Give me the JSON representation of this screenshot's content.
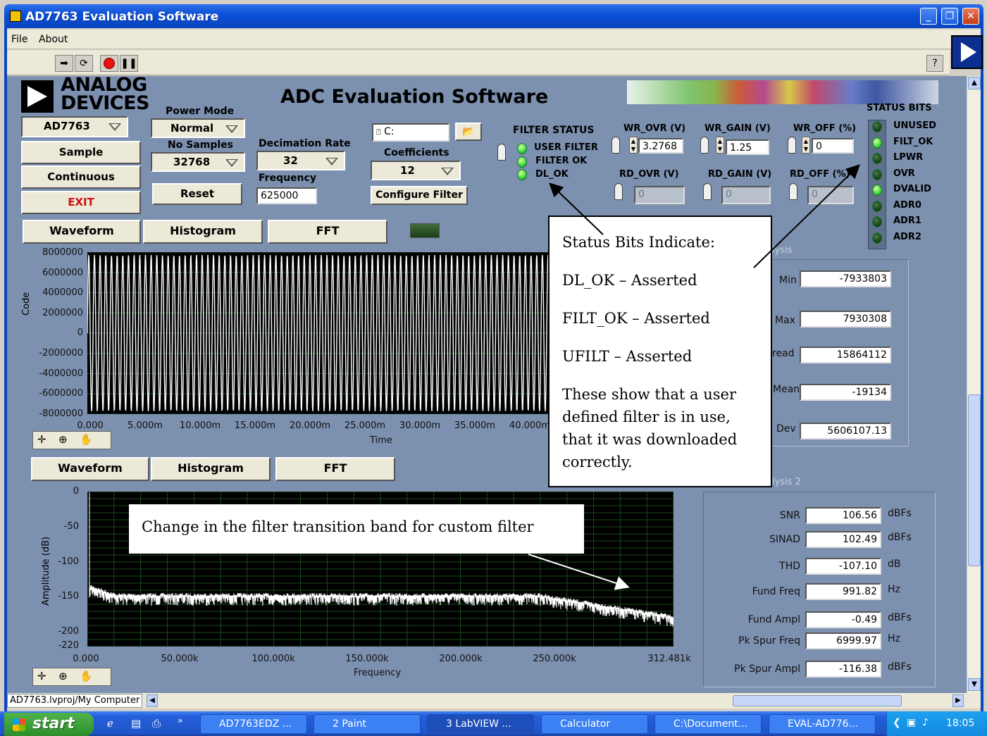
{
  "window": {
    "title": "AD7763 Evaluation Software",
    "minimize": "_",
    "maximize": "❐",
    "close": "✕"
  },
  "menu": {
    "file": "File",
    "about": "About"
  },
  "toolbar": {
    "help": "?"
  },
  "header": {
    "logo_line1": "ANALOG",
    "logo_line2": "DEVICES",
    "title": "ADC Evaluation Software"
  },
  "controls": {
    "device": "AD7763",
    "sample": "Sample",
    "continuous": "Continuous",
    "exit": "EXIT",
    "power_mode_label": "Power Mode",
    "power_mode": "Normal",
    "no_samples_label": "No Samples",
    "no_samples": "32768",
    "reset": "Reset",
    "decimation_label": "Decimation Rate",
    "decimation": "32",
    "frequency_label": "Frequency",
    "frequency": "625000",
    "path": "C:",
    "coefficients_label": "Coefficients",
    "coefficients": "12",
    "configure_filter": "Configure Filter"
  },
  "filter_status": {
    "label": "FILTER STATUS",
    "user_filter": "USER FILTER",
    "filter_ok": "FILTER OK",
    "dl_ok": "DL_OK"
  },
  "registers": {
    "wr_ovr_label": "WR_OVR (V)",
    "wr_ovr": "3.2768",
    "wr_gain_label": "WR_GAIN (V)",
    "wr_gain": "1.25",
    "wr_off_label": "WR_OFF (%)",
    "wr_off": "0",
    "rd_ovr_label": "RD_OVR (V)",
    "rd_ovr": "0",
    "rd_gain_label": "RD_GAIN (V)",
    "rd_gain": "0",
    "rd_off_label": "RD_OFF (%)",
    "rd_off": "0"
  },
  "status_bits": {
    "label": "STATUS BITS",
    "bits": [
      {
        "name": "UNUSED",
        "on": false
      },
      {
        "name": "FILT_OK",
        "on": true
      },
      {
        "name": "LPWR",
        "on": false
      },
      {
        "name": "OVR",
        "on": false
      },
      {
        "name": "DVALID",
        "on": true
      },
      {
        "name": "ADR0",
        "on": false
      },
      {
        "name": "ADR1",
        "on": false
      },
      {
        "name": "ADR2",
        "on": false
      }
    ]
  },
  "top_tabs": [
    "Waveform",
    "Histogram",
    "FFT"
  ],
  "bottom_tabs": [
    "Waveform",
    "Histogram",
    "FFT"
  ],
  "waveform": {
    "ylabel": "Code",
    "xlabel": "Time",
    "yticks": [
      "8000000",
      "6000000",
      "4000000",
      "2000000",
      "0",
      "-2000000",
      "-4000000",
      "-6000000",
      "-8000000"
    ],
    "xticks": [
      "0.000",
      "5.000m",
      "10.000m",
      "15.000m",
      "20.000m",
      "25.000m",
      "30.000m",
      "35.000m",
      "40.000m"
    ]
  },
  "fft": {
    "ylabel": "Amplitude (dB)",
    "xlabel": "Frequency",
    "yticks": [
      "0",
      "-50",
      "-100",
      "-150",
      "-200",
      "-220"
    ],
    "xticks": [
      "0.000",
      "50.000k",
      "100.000k",
      "150.000k",
      "200.000k",
      "250.000k",
      "312.481k"
    ]
  },
  "analysis": {
    "tab_fragment": "lysis",
    "min_label": "Min",
    "min": "-7933803",
    "max_label": "Max",
    "max": "7930308",
    "spread_label": "read",
    "spread": "15864112",
    "mean_label": "Mean",
    "mean": "-19134",
    "dev_label": "Dev",
    "dev": "5606107.13"
  },
  "analysis2": {
    "tab_fragment": "lysis 2",
    "rows": [
      {
        "label": "SNR",
        "value": "106.56",
        "unit": "dBFs"
      },
      {
        "label": "SINAD",
        "value": "102.49",
        "unit": "dBFs"
      },
      {
        "label": "THD",
        "value": "-107.10",
        "unit": "dB"
      },
      {
        "label": "Fund Freq",
        "value": "991.82",
        "unit": "Hz"
      },
      {
        "label": "Fund Ampl",
        "value": "-0.49",
        "unit": "dBFs"
      },
      {
        "label": "Pk Spur Freq",
        "value": "6999.97",
        "unit": "Hz"
      },
      {
        "label": "Pk Spur Ampl",
        "value": "-116.38",
        "unit": "dBFs"
      }
    ]
  },
  "callout_status": {
    "line1": "Status Bits Indicate:",
    "line2": "DL_OK – Asserted",
    "line3": "FILT_OK – Asserted",
    "line4": "UFILT – Asserted",
    "line5": "These show that a user defined filter is in use, that it was downloaded correctly."
  },
  "callout_filter": {
    "text": "Change in the filter transition band for custom filter"
  },
  "statusbar": {
    "path": "AD7763.lvproj/My Computer"
  },
  "taskbar": {
    "start": "start",
    "tasks": [
      "AD7763EDZ ...",
      "2 Paint",
      "3 LabVIEW ...",
      "Calculator",
      "C:\\Document...",
      "EVAL-AD776..."
    ],
    "clock": "18:05"
  }
}
